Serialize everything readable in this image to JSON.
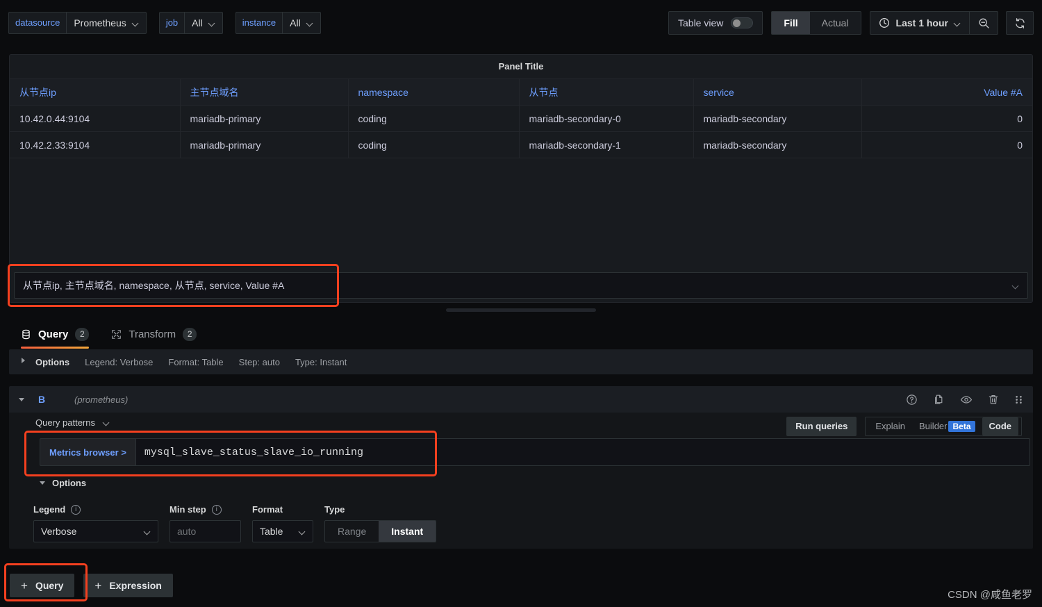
{
  "toolbar": {
    "variables": [
      {
        "label": "datasource",
        "value": "Prometheus",
        "icon": "chevron-down-icon"
      },
      {
        "label": "job",
        "value": "All",
        "icon": "chevron-down-icon"
      },
      {
        "label": "instance",
        "value": "All",
        "icon": "chevron-down-icon"
      }
    ],
    "table_view_label": "Table view",
    "table_view_on": false,
    "fill_actual": {
      "options": [
        "Fill",
        "Actual"
      ],
      "selected": "Fill"
    },
    "time_range": "Last 1 hour",
    "icons": {
      "clock": "clock-icon",
      "zoom_out": "zoom-out-icon",
      "refresh": "refresh-icon"
    }
  },
  "panel": {
    "title": "Panel Title",
    "table": {
      "columns": [
        "从节点ip",
        "主节点域名",
        "namespace",
        "从节点",
        "service",
        "Value #A"
      ],
      "rows": [
        [
          "10.42.0.44:9104",
          "mariadb-primary",
          "coding",
          "mariadb-secondary-0",
          "mariadb-secondary",
          "0"
        ],
        [
          "10.42.2.33:9104",
          "mariadb-primary",
          "coding",
          "mariadb-secondary-1",
          "mariadb-secondary",
          "0"
        ]
      ]
    }
  },
  "field_selector": {
    "value": "从节点ip, 主节点域名, namespace, 从节点, service, Value #A",
    "chevron": "chevron-down-icon"
  },
  "tabs": [
    {
      "label": "Query",
      "badge": "2",
      "icon": "database-icon",
      "active": true
    },
    {
      "label": "Transform",
      "badge": "2",
      "icon": "transform-icon",
      "active": false
    }
  ],
  "query_options_summary": {
    "expand_label": "Options",
    "legend": "Legend: Verbose",
    "format": "Format: Table",
    "step": "Step: auto",
    "type": "Type: Instant"
  },
  "query_row": {
    "ref_id": "B",
    "datasource": "(prometheus)",
    "icons": [
      "help-icon",
      "duplicate-icon",
      "eye-icon",
      "trash-icon",
      "drag-handle-icon"
    ]
  },
  "query_editor": {
    "query_patterns_label": "Query patterns",
    "run_queries_label": "Run queries",
    "explain_label": "Explain",
    "builder_label": "Builder",
    "beta_label": "Beta",
    "code_label": "Code",
    "metrics_browser_label": "Metrics browser >",
    "expression": "mysql_slave_status_slave_io_running",
    "options_label": "Options",
    "fields": {
      "legend_label": "Legend",
      "legend_value": "Verbose",
      "min_step_label": "Min step",
      "min_step_placeholder": "auto",
      "format_label": "Format",
      "format_value": "Table",
      "type_label": "Type",
      "type_options": [
        "Range",
        "Instant"
      ],
      "type_selected": "Instant"
    }
  },
  "bottom": {
    "add_query_label": "Query",
    "add_expression_label": "Expression"
  },
  "watermark": "CSDN @咸鱼老罗",
  "colors": {
    "accent_blue": "#6e9fff",
    "highlight_red": "#f4401f",
    "beta_blue": "#3274d9",
    "tab_underline": "#f55f3e",
    "background": "#0b0c0e",
    "panel_bg": "#181b1f"
  }
}
